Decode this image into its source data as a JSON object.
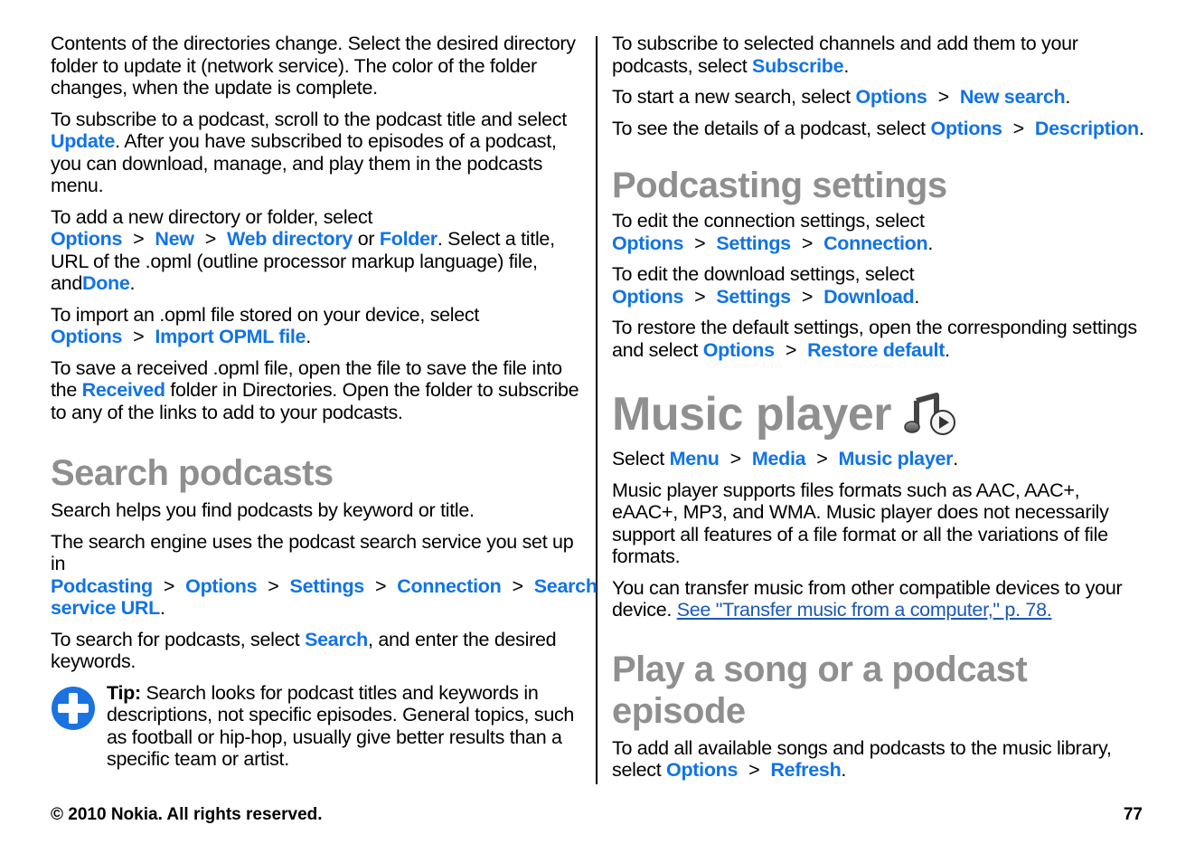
{
  "left": {
    "p1": "Contents of the directories change. Select the desired directory folder to update it (network service). The color of the folder changes, when the update is complete.",
    "p2": {
      "a": "To subscribe to a podcast, scroll to the podcast title and select ",
      "l1": "Update",
      "b": ". After you have subscribed to episodes of a podcast, you can download, manage, and play them in the podcasts menu."
    },
    "p3": {
      "a": "To add a new directory or folder, select ",
      "l1": "Options",
      "l2": "New",
      "l3": "Web directory",
      "b": " or ",
      "l4": "Folder",
      "c": ". Select a title, URL of the .opml (outline processor markup language) file, and",
      "l5": "Done",
      "d": "."
    },
    "p4": {
      "a": "To import an .opml file stored on your device, select ",
      "l1": "Options",
      "l2": "Import OPML file",
      "b": "."
    },
    "p5": {
      "a": "To save a received .opml file, open the file to save the file into the ",
      "l1": "Received",
      "b": " folder in Directories. Open the folder to subscribe to any of the links to add to your podcasts."
    },
    "search_heading": "Search podcasts",
    "p6": "Search helps you find podcasts by keyword or title.",
    "p7": {
      "a": "The search engine uses the podcast search service you set up in ",
      "l1": "Podcasting",
      "l2": "Options",
      "l3": "Settings",
      "l4": "Connection",
      "l5": "Search service URL",
      "b": "."
    },
    "p8": {
      "a": "To search for podcasts, select ",
      "l1": "Search",
      "b": ", and enter the desired keywords."
    },
    "tip": {
      "label": "Tip:",
      "text": " Search looks for podcast titles and keywords in descriptions, not specific episodes. General topics, such as football or hip-hop, usually give better results than a specific team or artist.",
      "icon": "plus-circle-icon"
    }
  },
  "right": {
    "p1": {
      "a": "To subscribe to selected channels and add them to your podcasts, select ",
      "l1": "Subscribe",
      "b": "."
    },
    "p2": {
      "a": "To start a new search, select ",
      "l1": "Options",
      "l2": "New search",
      "b": "."
    },
    "p3": {
      "a": "To see the details of a podcast, select ",
      "l1": "Options",
      "l2": "Description",
      "b": "."
    },
    "settings_heading": "Podcasting settings",
    "p4": {
      "a": "To edit the connection settings, select ",
      "l1": "Options",
      "l2": "Settings",
      "l3": "Connection",
      "b": "."
    },
    "p5": {
      "a": "To edit the download settings, select ",
      "l1": "Options",
      "l2": "Settings",
      "l3": "Download",
      "b": "."
    },
    "p6": {
      "a": "To restore the default settings, open the corresponding settings and select ",
      "l1": "Options",
      "l2": "Restore default",
      "b": "."
    },
    "music_heading": "Music player",
    "music_icon": "music-player-icon",
    "p7": {
      "a": "Select ",
      "l1": "Menu",
      "l2": "Media",
      "l3": "Music player",
      "b": "."
    },
    "p8": "Music player supports files formats such as AAC, AAC+, eAAC+, MP3, and WMA. Music player does not necessarily support all features of a file format or all the variations of file formats.",
    "p9": {
      "a": "You can transfer music from other compatible devices to your device. ",
      "xref": "See \"Transfer music from a computer,\" p. 78."
    },
    "play_heading": "Play a song or a podcast episode",
    "p10": {
      "a": "To add all available songs and podcasts to the music library, select ",
      "l1": "Options",
      "l2": "Refresh",
      "b": "."
    }
  },
  "common": {
    "sep": ">"
  },
  "footer": {
    "copyright": "© 2010 Nokia. All rights reserved.",
    "page_number": "77"
  },
  "colors": {
    "link": "#1173e6",
    "heading": "#8f8f8f"
  }
}
